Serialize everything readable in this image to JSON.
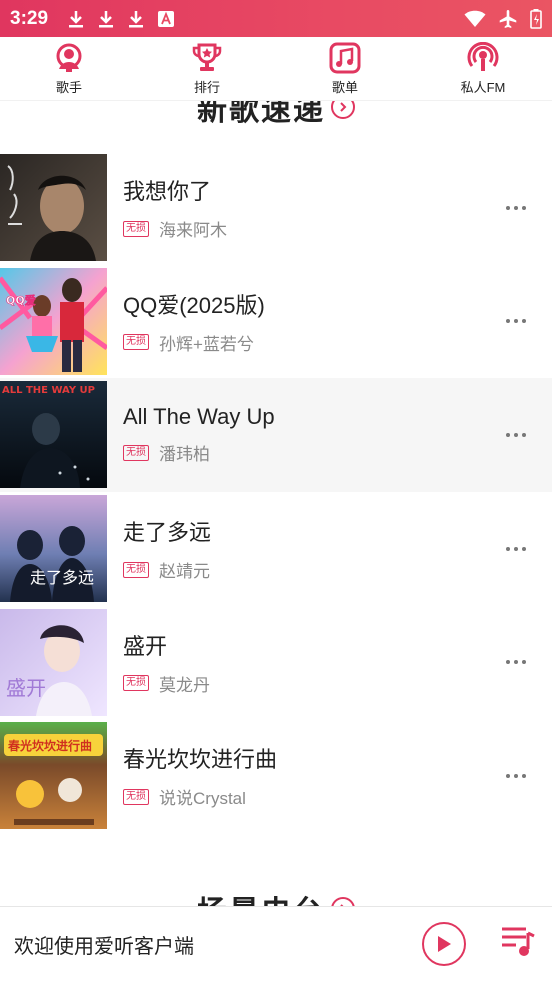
{
  "status_bar": {
    "time": "3:29",
    "left_icons": [
      "download-icon",
      "download-icon",
      "download-icon",
      "a-icon"
    ],
    "right_icons": [
      "wifi-icon",
      "airplane-mode-icon",
      "battery-icon"
    ]
  },
  "nav": {
    "items": [
      {
        "label": "歌手",
        "icon": "singer-icon"
      },
      {
        "label": "排行",
        "icon": "trophy-icon"
      },
      {
        "label": "歌单",
        "icon": "music-note-icon"
      },
      {
        "label": "私人FM",
        "icon": "radio-icon"
      }
    ]
  },
  "sections": {
    "new_songs_title": "新歌速递",
    "next_title": "场景电台"
  },
  "songs": [
    {
      "title": "我想你了",
      "artist": "海来阿木",
      "badge": "无损"
    },
    {
      "title": "QQ爱(2025版)",
      "artist": "孙辉+蓝若兮",
      "badge": "无损"
    },
    {
      "title": "All The Way Up",
      "artist": "潘玮柏",
      "badge": "无损"
    },
    {
      "title": "走了多远",
      "artist": "赵靖元",
      "badge": "无损"
    },
    {
      "title": "盛开",
      "artist": "莫龙丹",
      "badge": "无损"
    },
    {
      "title": "春光坎坎进行曲",
      "artist": "说说Crystal",
      "badge": "无损"
    }
  ],
  "covers": {
    "1": {
      "text": "QQ爱"
    },
    "2": {
      "text": "ALL THE WAY UP"
    },
    "3": {
      "text": "走了多远"
    },
    "4": {
      "text": "盛开"
    },
    "5": {
      "text": "春光坎坎进行曲"
    }
  },
  "player": {
    "text": "欢迎使用爱听客户端"
  },
  "colors": {
    "accent": "#e0365f",
    "status_bar": "#e84a63"
  }
}
